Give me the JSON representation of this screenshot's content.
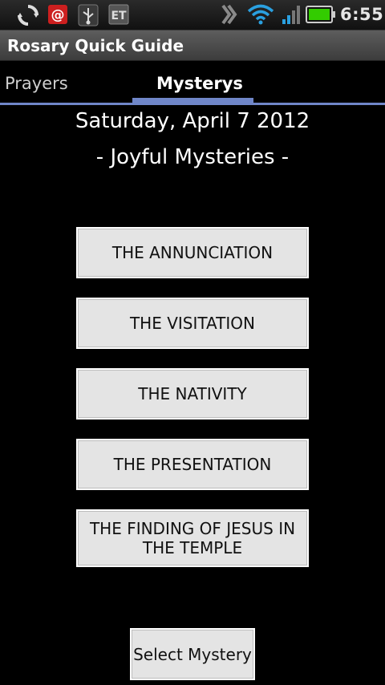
{
  "status_bar": {
    "time": "6:55",
    "icons": [
      "sync-icon",
      "email-notification-icon",
      "usb-icon",
      "et-app-icon",
      "signal-strength-icon",
      "wifi-icon",
      "cellular-signal-icon",
      "battery-icon"
    ],
    "et_label": "ET",
    "battery_color": "#33cc00"
  },
  "app": {
    "title": "Rosary Quick Guide"
  },
  "tabs": [
    {
      "label": "Prayers",
      "selected": false
    },
    {
      "label": "Mysterys",
      "selected": true
    }
  ],
  "tab_accent_color": "#6f86c8",
  "content": {
    "date": "Saturday, April 7 2012",
    "mystery_set": "- Joyful Mysteries -",
    "mysteries": [
      "THE ANNUNCIATION",
      "THE VISITATION",
      "THE NATIVITY",
      "THE PRESENTATION",
      "THE FINDING OF JESUS IN THE TEMPLE"
    ],
    "select_button": "Select Mystery"
  }
}
